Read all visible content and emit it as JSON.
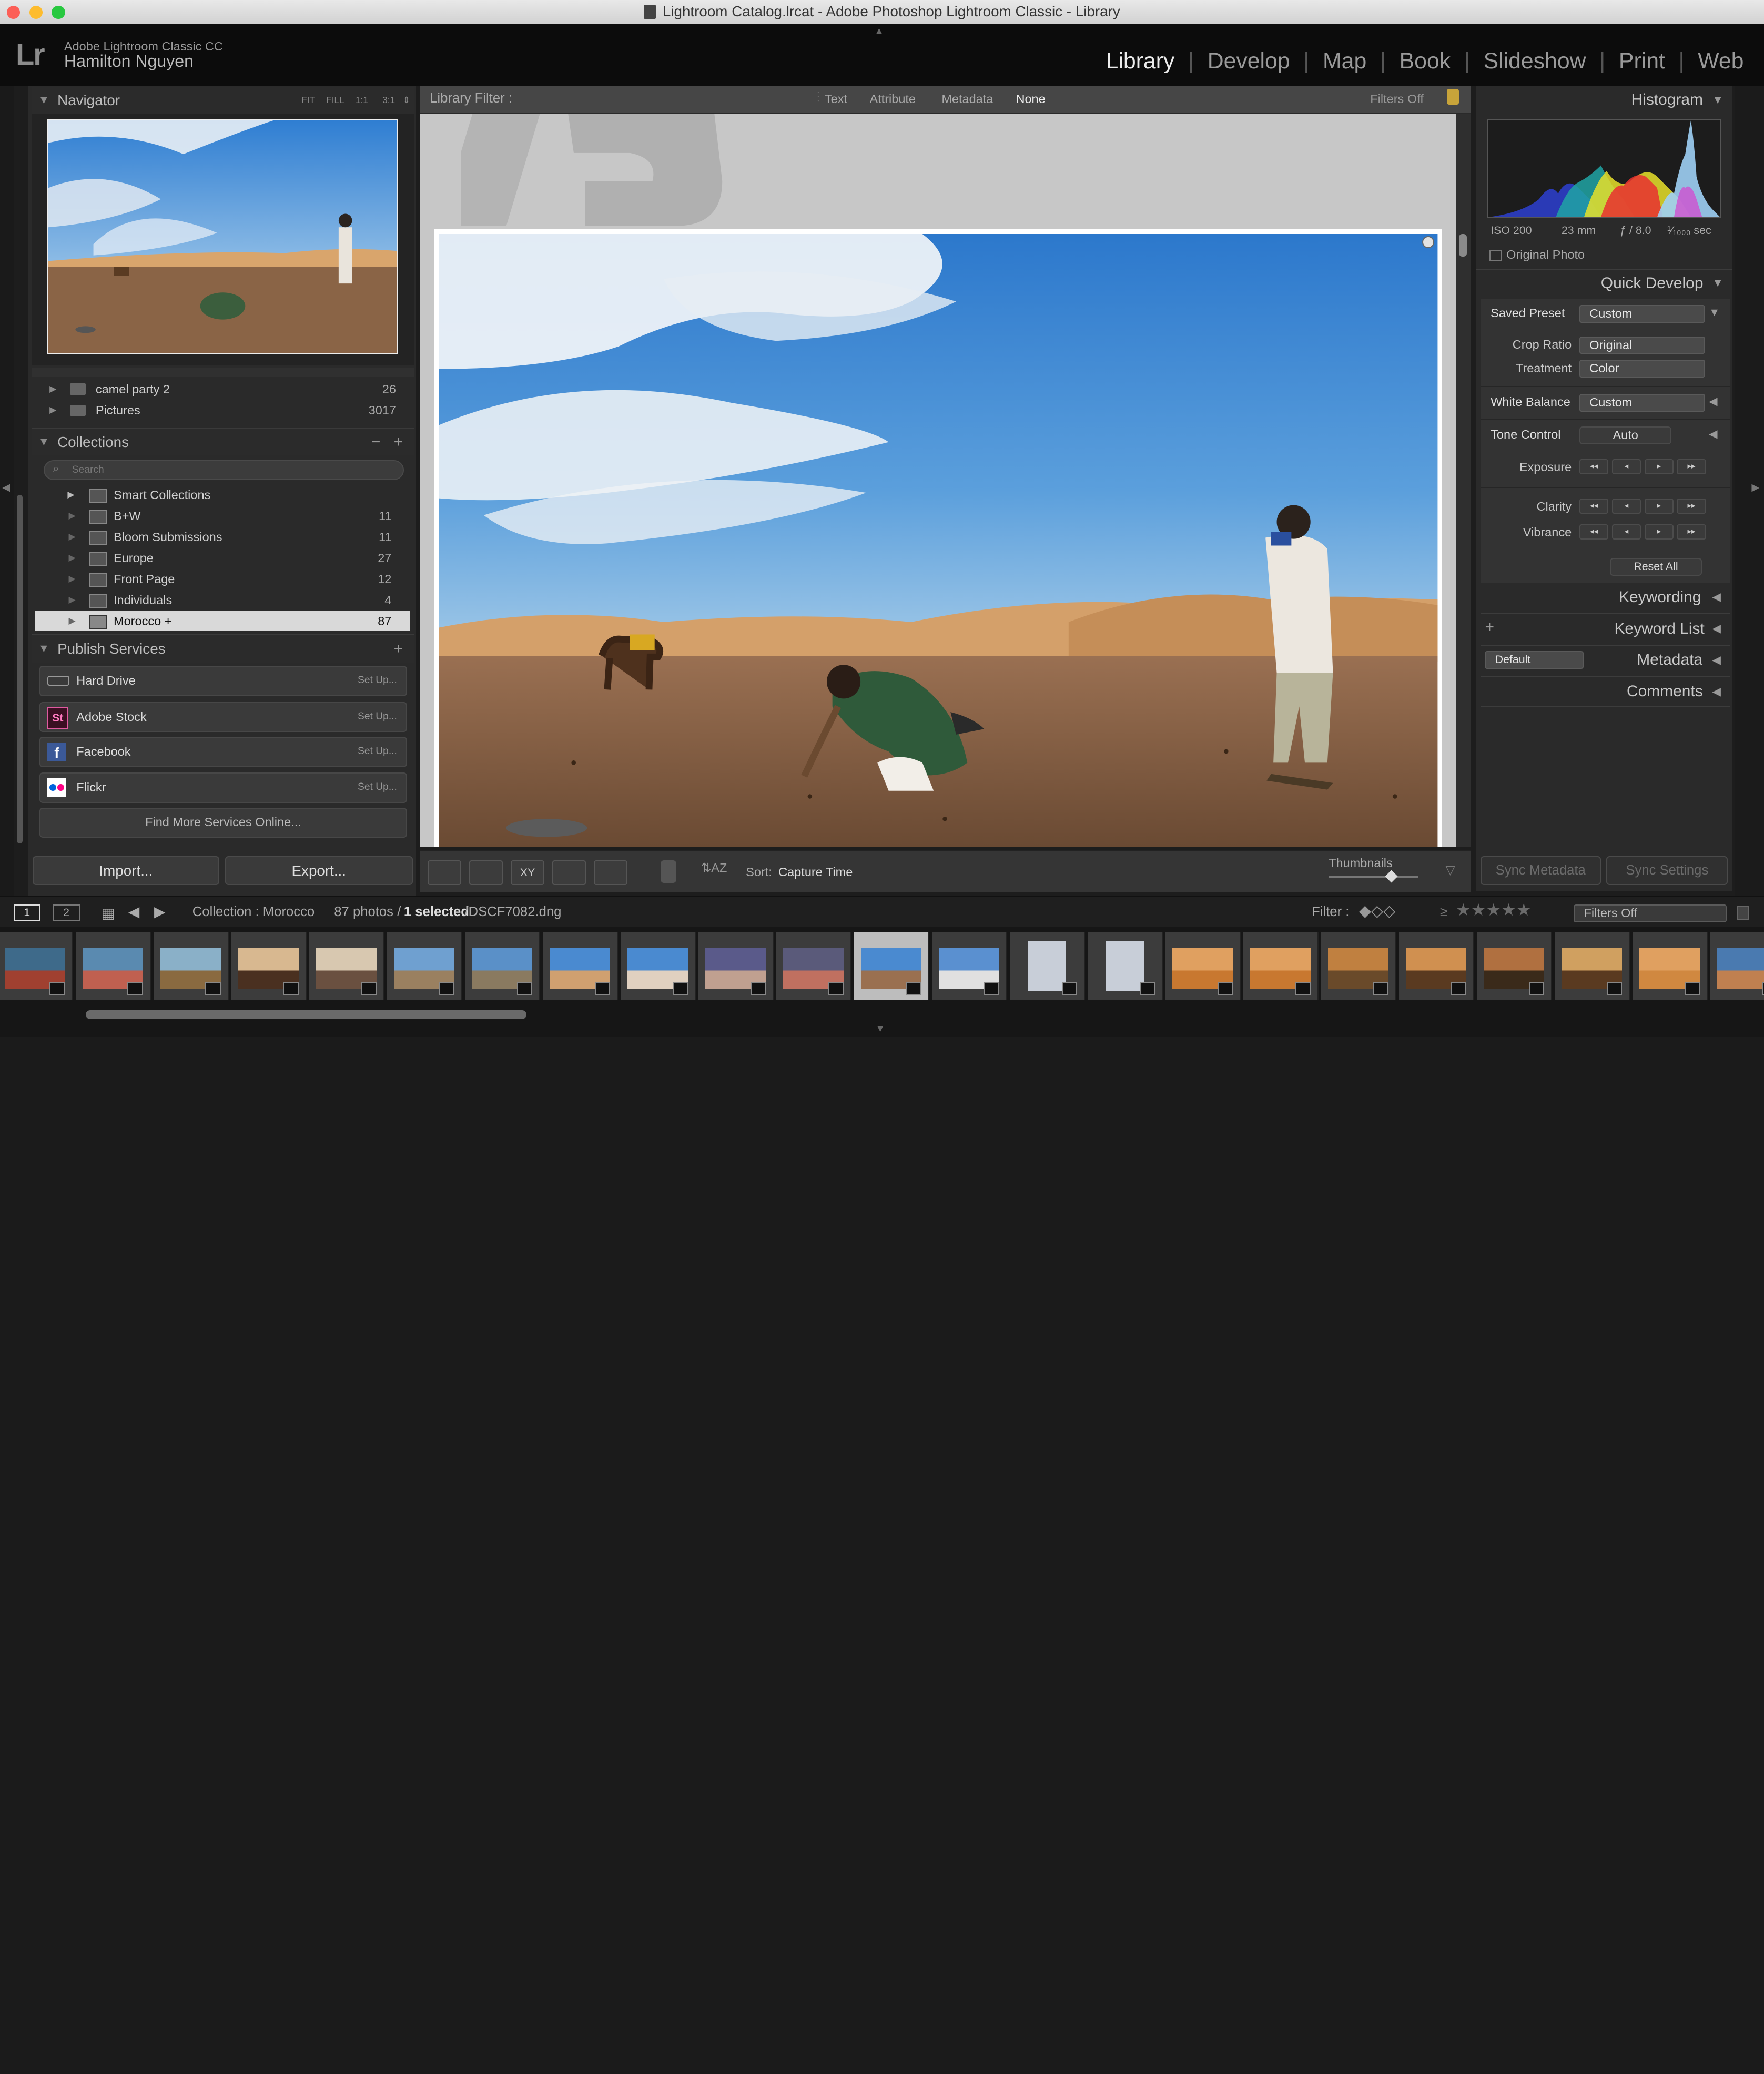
{
  "window": {
    "title": "Lightroom Catalog.lrcat - Adobe Photoshop Lightroom Classic - Library"
  },
  "identity": {
    "logo": "Lr",
    "app_name": "Adobe Lightroom Classic CC",
    "user_name": "Hamilton Nguyen"
  },
  "modules": [
    "Library",
    "Develop",
    "Map",
    "Book",
    "Slideshow",
    "Print",
    "Web"
  ],
  "active_module": "Library",
  "navigator": {
    "title": "Navigator",
    "zoom_options": [
      "FIT",
      "FILL",
      "1:1",
      "3:1"
    ]
  },
  "folders": [
    {
      "name": "camel party 2",
      "count": "26"
    },
    {
      "name": "Pictures",
      "count": "3017"
    }
  ],
  "collections": {
    "title": "Collections",
    "minus": "−",
    "plus": "+",
    "search_placeholder": "Search",
    "items": [
      {
        "name": "Smart Collections",
        "count": ""
      },
      {
        "name": "B+W",
        "count": "11"
      },
      {
        "name": "Bloom Submissions",
        "count": "11"
      },
      {
        "name": "Europe",
        "count": "27"
      },
      {
        "name": "Front Page",
        "count": "12"
      },
      {
        "name": "Individuals",
        "count": "4"
      },
      {
        "name": "Morocco  +",
        "count": "87"
      }
    ]
  },
  "publish": {
    "title": "Publish Services",
    "plus": "+",
    "services": [
      {
        "name": "Hard Drive",
        "action": "Set Up..."
      },
      {
        "name": "Adobe Stock",
        "action": "Set Up..."
      },
      {
        "name": "Facebook",
        "action": "Set Up..."
      },
      {
        "name": "Flickr",
        "action": "Set Up..."
      }
    ],
    "find_more": "Find More Services Online..."
  },
  "left_buttons": {
    "import": "Import...",
    "export": "Export..."
  },
  "library_filter": {
    "label": "Library Filter :",
    "options": [
      "Text",
      "Attribute",
      "Metadata",
      "None"
    ],
    "active": "None",
    "filters_off": "Filters Off"
  },
  "toolbar": {
    "sort_label": "Sort:",
    "sort_value": "Capture Time",
    "thumbnails_label": "Thumbnails",
    "thumbnail_size": 0.7
  },
  "histogram": {
    "title": "Histogram",
    "iso": "ISO 200",
    "focal": "23 mm",
    "aperture": "ƒ / 8.0",
    "shutter": "¹⁄₁₀₀₀ sec",
    "original_photo": "Original Photo"
  },
  "quick_develop": {
    "title": "Quick Develop",
    "saved_preset_label": "Saved Preset",
    "saved_preset": "Custom",
    "crop_label": "Crop Ratio",
    "crop": "Original",
    "treatment_label": "Treatment",
    "treatment": "Color",
    "wb_label": "White Balance",
    "wb": "Custom",
    "tone_label": "Tone Control",
    "auto": "Auto",
    "exposure_label": "Exposure",
    "clarity_label": "Clarity",
    "vibrance_label": "Vibrance",
    "reset_all": "Reset All",
    "stepper_symbols": [
      "◂◂",
      "◂",
      "▸",
      "▸▸"
    ]
  },
  "right_panels": {
    "keywording": "Keywording",
    "keyword_list": "Keyword List",
    "metadata": "Metadata",
    "metadata_preset": "Default",
    "comments": "Comments",
    "sync_metadata": "Sync Metadata",
    "sync_settings": "Sync Settings"
  },
  "filmstrip_bar": {
    "screen1": "1",
    "screen2": "2",
    "source": "Collection : Morocco",
    "count_pre": "87 photos /",
    "selected": "1 selected",
    "file": "/DSCF7082.dng",
    "filter_label": "Filter :",
    "filter_value": "Filters Off",
    "rating_compare": "≥"
  },
  "colors": {
    "accent": "#e9e9e9",
    "sky": "#3f87d0",
    "sand": "#b07a48",
    "ground": "#7a5a40"
  }
}
